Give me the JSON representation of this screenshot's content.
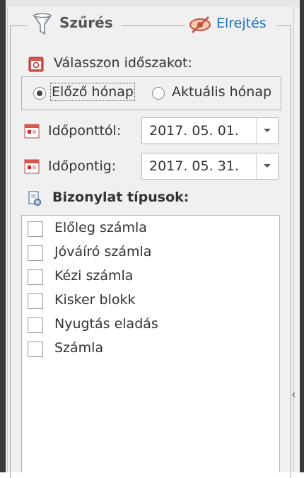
{
  "header": {
    "title": "Szűrés",
    "hide_label": "Elrejtés",
    "filter_icon": "filter-funnel-icon",
    "hide_icon": "eye-crossed-icon"
  },
  "period": {
    "label": "Válasszon időszakot:",
    "icon": "calendar-red-icon",
    "options": [
      {
        "label": "Előző hónap",
        "selected": true
      },
      {
        "label": "Aktuális hónap",
        "selected": false
      }
    ]
  },
  "dates": {
    "from_label": "Időponttól:",
    "from_value": "2017. 05. 01.",
    "to_label": "Időpontig:",
    "to_value": "2017. 05. 31.",
    "icon": "calendar-grid-icon"
  },
  "doc_types": {
    "label": "Bizonylat típusok:",
    "icon": "document-settings-icon",
    "items": [
      {
        "label": "Előleg számla",
        "checked": false
      },
      {
        "label": "Jóváíró számla",
        "checked": false
      },
      {
        "label": "Kézi számla",
        "checked": false
      },
      {
        "label": "Kisker blokk",
        "checked": false
      },
      {
        "label": "Nyugtás eladás",
        "checked": false
      },
      {
        "label": "Számla",
        "checked": false
      }
    ]
  },
  "collapse_handle": "‹",
  "colors": {
    "link": "#1e6fbf",
    "icon_red": "#c9302c",
    "panel_bg": "#f0f0f0"
  }
}
